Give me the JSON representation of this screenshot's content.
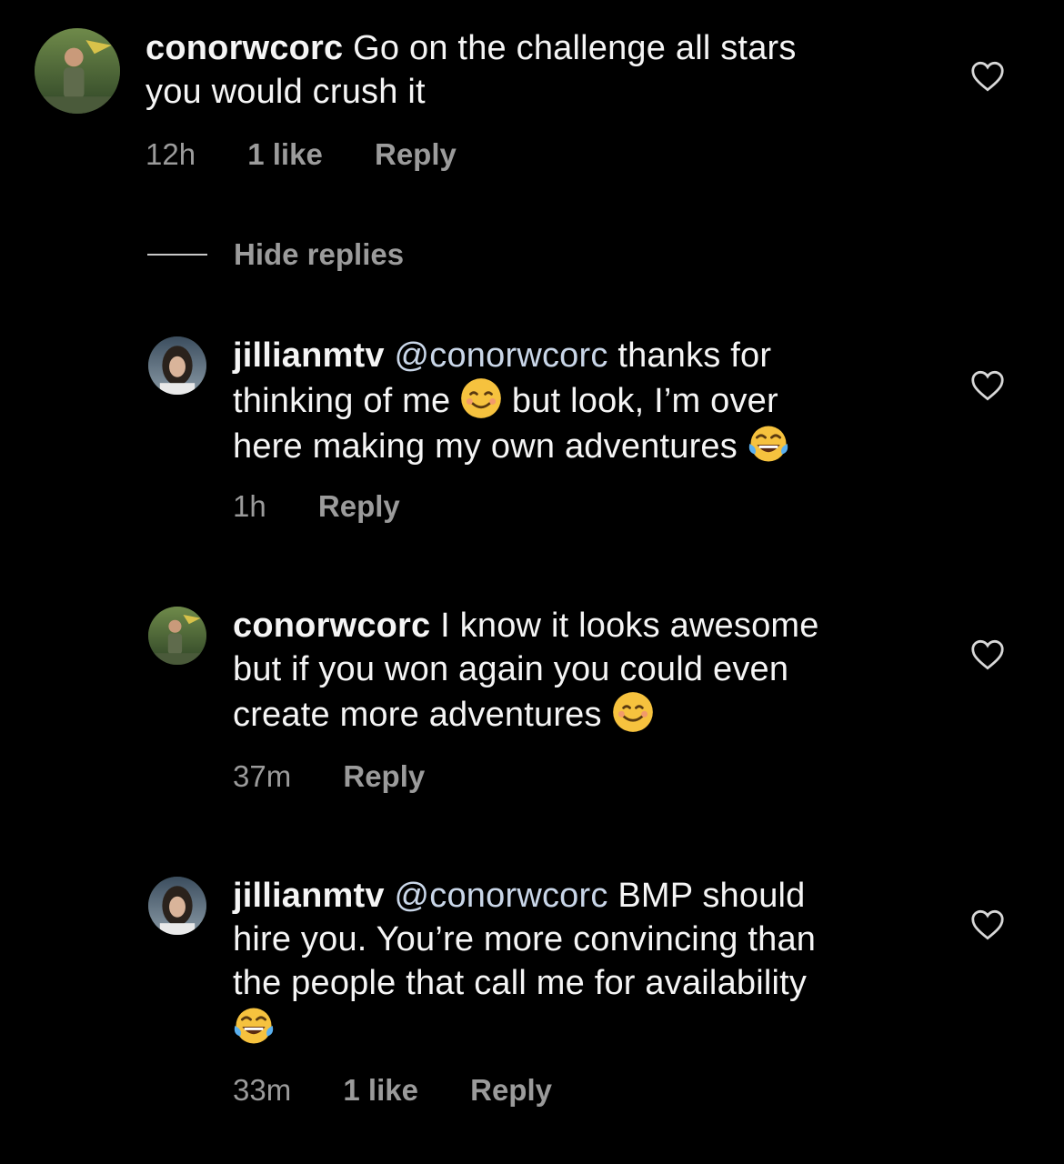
{
  "comments": [
    {
      "username": "conorwcorc",
      "lines": [
        "Go on the challenge all stars",
        "you would crush it"
      ],
      "time": "12h",
      "likes": "1 like",
      "reply": "Reply"
    },
    {
      "username": "jillianmtv",
      "mention": "@conorwcorc",
      "line1_rest": "thanks for",
      "line2": "thinking of me",
      "line2b": "but look, I’m over",
      "line3": "here making my own adventures",
      "time": "1h",
      "reply": "Reply"
    },
    {
      "username": "conorwcorc",
      "line1_rest": "I know it looks awesome",
      "line2": "but if you won again you could even",
      "line3": "create more adventures",
      "time": "37m",
      "reply": "Reply"
    },
    {
      "username": "jillianmtv",
      "mention": "@conorwcorc",
      "line1_rest": "BMP should",
      "line2": "hire you.  You’re more convincing than",
      "line3": "the people that call me for availability",
      "time": "33m",
      "likes": "1 like",
      "reply": "Reply"
    }
  ],
  "hide_replies": "Hide replies",
  "colors": {
    "background": "#000000",
    "text": "#f5f5f5",
    "meta": "#9b9b9b",
    "mention": "#c9d6e8"
  }
}
